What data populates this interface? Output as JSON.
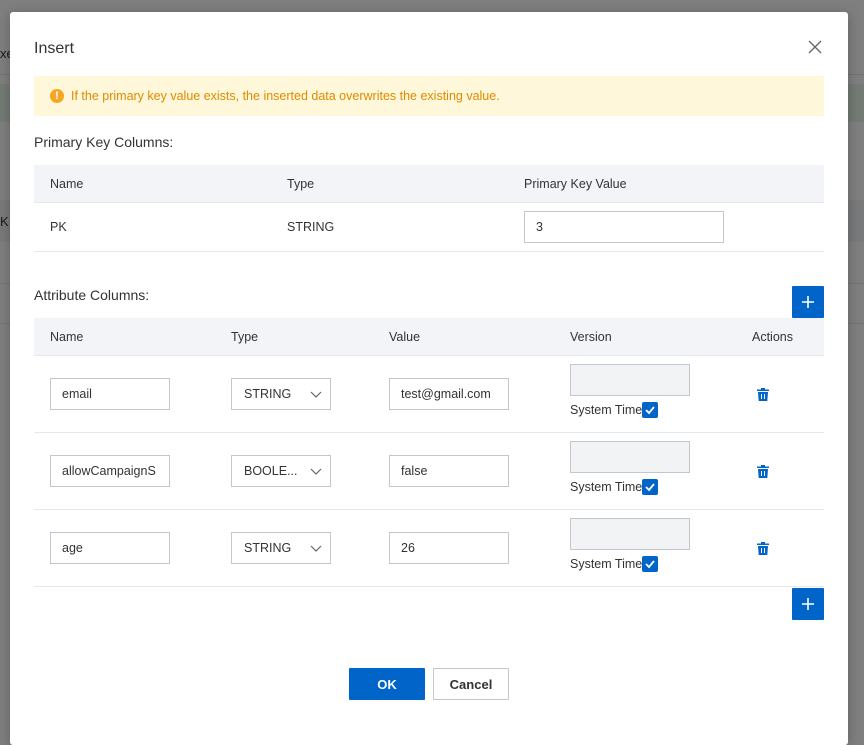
{
  "background": {
    "fragments": [
      "xe",
      "K"
    ]
  },
  "dialog": {
    "title": "Insert",
    "alert_text": "If the primary key value exists, the inserted data overwrites the existing value.",
    "primary_key_section": {
      "label": "Primary Key Columns:",
      "headers": [
        "Name",
        "Type",
        "Primary Key Value"
      ],
      "rows": [
        {
          "name": "PK",
          "type": "STRING",
          "value": "3"
        }
      ]
    },
    "attribute_section": {
      "label": "Attribute Columns:",
      "headers": [
        "Name",
        "Type",
        "Value",
        "Version",
        "Actions"
      ],
      "rows": [
        {
          "name": "email",
          "type": "STRING",
          "value": "test@gmail.com",
          "version": "",
          "system_time_label": "System Time",
          "system_time_checked": true
        },
        {
          "name": "allowCampaignS",
          "type": "BOOLE...",
          "value": "false",
          "version": "",
          "system_time_label": "System Time",
          "system_time_checked": true
        },
        {
          "name": "age",
          "type": "STRING",
          "value": "26",
          "version": "",
          "system_time_label": "System Time",
          "system_time_checked": true
        }
      ]
    },
    "ok_label": "OK",
    "cancel_label": "Cancel"
  },
  "colors": {
    "primary": "#0064c8",
    "warning_bg": "#fff7d9",
    "warning_text": "#e08a00",
    "warning_icon": "#f5a623"
  },
  "icons": {
    "close": "close-icon",
    "alert": "warning-icon",
    "chevron": "chevron-down-icon",
    "trash": "trash-icon",
    "plus": "plus-icon",
    "check": "check-icon"
  }
}
